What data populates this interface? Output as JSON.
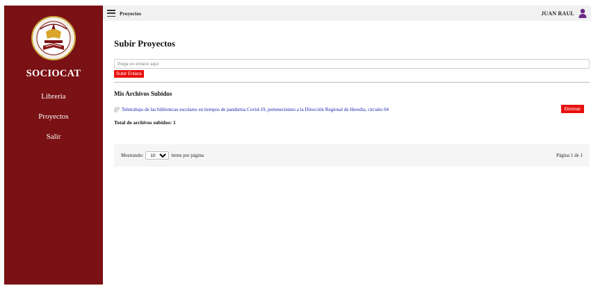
{
  "sidebar": {
    "brand": "SOCIOCAT",
    "items": [
      {
        "label": "Libreria"
      },
      {
        "label": "Proyectos"
      },
      {
        "label": "Salir"
      }
    ]
  },
  "topbar": {
    "title": "Proyectos",
    "user_name": "JUAN RAUL"
  },
  "main": {
    "title": "Subir Proyectos",
    "link_placeholder": "Pega un enlace aquí",
    "submit_label": "Subir Enlace",
    "files_title": "Mis Archivos Subidos",
    "files": [
      {
        "name": "Teletrabajo de las bibliotecas escolares en tiempos de pandemia Covid-19, pertenecientes a la Dirección Regional de Heredia, circuito 04",
        "delete_label": "Eliminar"
      }
    ],
    "total": "Total de archivos subidos: 1"
  },
  "pagination": {
    "showing_label": "Mostrando:",
    "per_page": "10",
    "per_page_suffix": "items por página",
    "page_info": "Página 1 de 1"
  },
  "colors": {
    "sidebar": "#7a1114",
    "accent_red": "#e8110f",
    "link_blue": "#1a23b0"
  }
}
